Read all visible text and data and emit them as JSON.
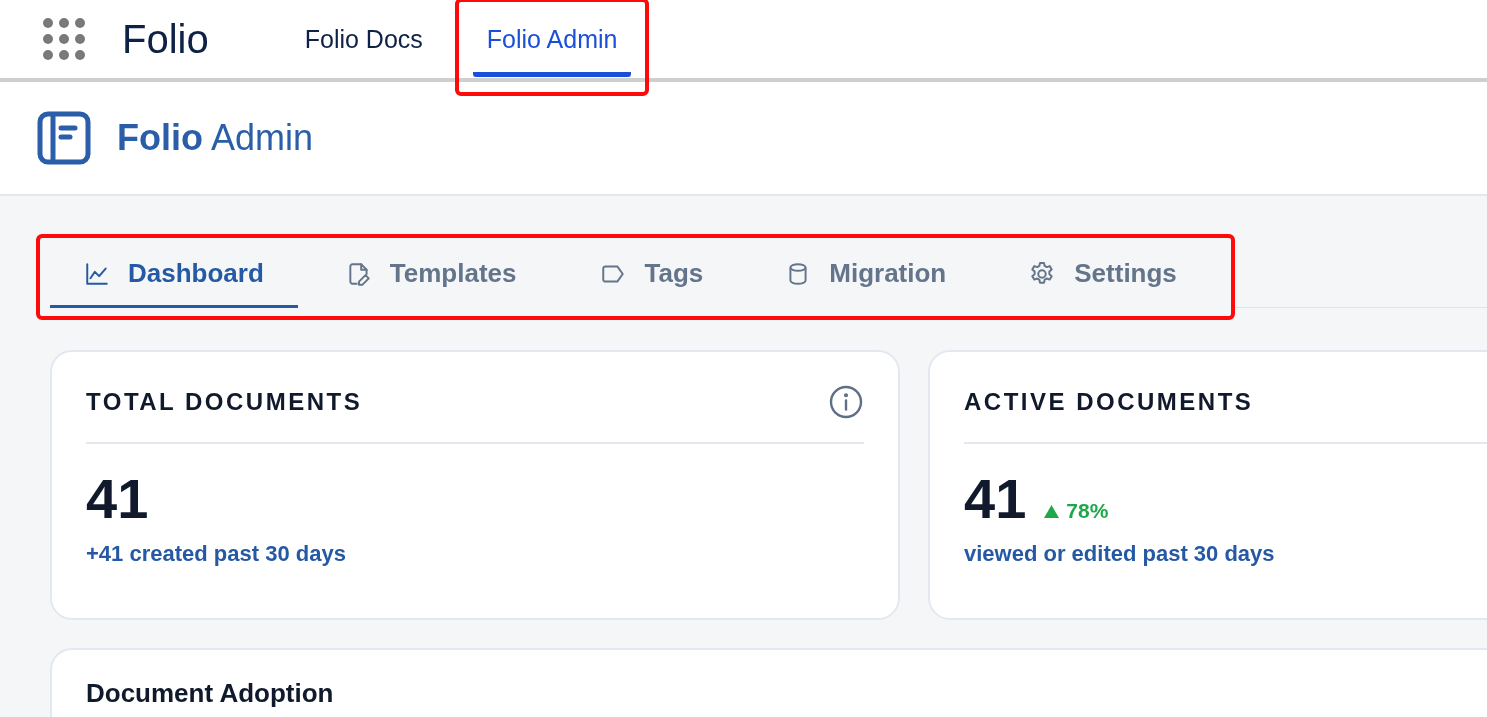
{
  "app_bar": {
    "app_name": "Folio",
    "items": [
      {
        "label": "Folio Docs",
        "selected": false,
        "highlighted": false
      },
      {
        "label": "Folio Admin",
        "selected": true,
        "highlighted": true
      }
    ]
  },
  "header": {
    "title_bold": "Folio",
    "title_rest": "Admin"
  },
  "tabs": {
    "highlighted": true,
    "items": [
      {
        "label": "Dashboard",
        "selected": true
      },
      {
        "label": "Templates",
        "selected": false
      },
      {
        "label": "Tags",
        "selected": false
      },
      {
        "label": "Migration",
        "selected": false
      },
      {
        "label": "Settings",
        "selected": false
      }
    ]
  },
  "cards": [
    {
      "title": "TOTAL DOCUMENTS",
      "info": true,
      "value": "41",
      "caption": "+41 created past 30 days"
    },
    {
      "title": "ACTIVE DOCUMENTS",
      "info": false,
      "value": "41",
      "trend": "78%",
      "caption": "viewed or edited past 30 days"
    }
  ],
  "section": {
    "title": "Document Adoption"
  }
}
